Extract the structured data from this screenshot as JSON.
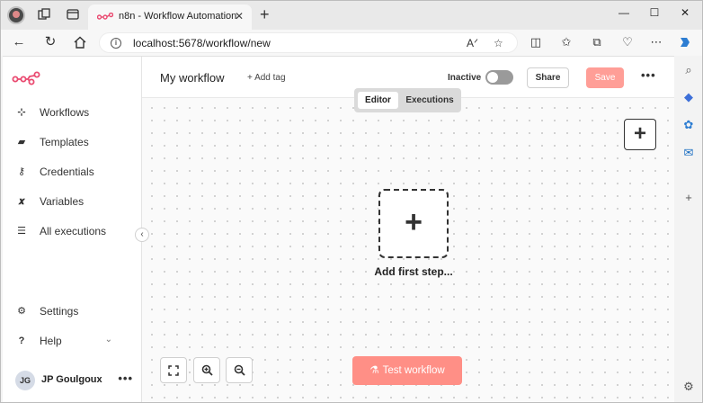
{
  "browser": {
    "tab_title": "n8n - Workflow Automation",
    "tab_close": "✕",
    "new_tab": "+",
    "url": "localhost:5678/workflow/new",
    "window_controls": {
      "minimize": "—",
      "maximize": "☐",
      "close": "✕"
    }
  },
  "sidebar": {
    "items": [
      {
        "label": "Workflows",
        "icon": "workflows-icon"
      },
      {
        "label": "Templates",
        "icon": "templates-icon"
      },
      {
        "label": "Credentials",
        "icon": "key-icon"
      },
      {
        "label": "Variables",
        "icon": "variables-icon"
      },
      {
        "label": "All executions",
        "icon": "list-icon"
      }
    ],
    "settings_label": "Settings",
    "help_label": "Help",
    "user": {
      "initials": "JG",
      "name": "JP Goulgoux",
      "more": "•••"
    }
  },
  "header": {
    "workflow_name": "My workflow",
    "add_tag": "+ Add tag",
    "active_state": "Inactive",
    "share_label": "Share",
    "save_label": "Save",
    "more": "•••"
  },
  "canvas": {
    "tabs": {
      "editor": "Editor",
      "executions": "Executions"
    },
    "add_first_step": "Add first step...",
    "test_workflow": "Test workflow"
  },
  "colors": {
    "brand": "#ea4b71",
    "save_button": "#ff9e97",
    "test_button": "#ff8f86"
  }
}
